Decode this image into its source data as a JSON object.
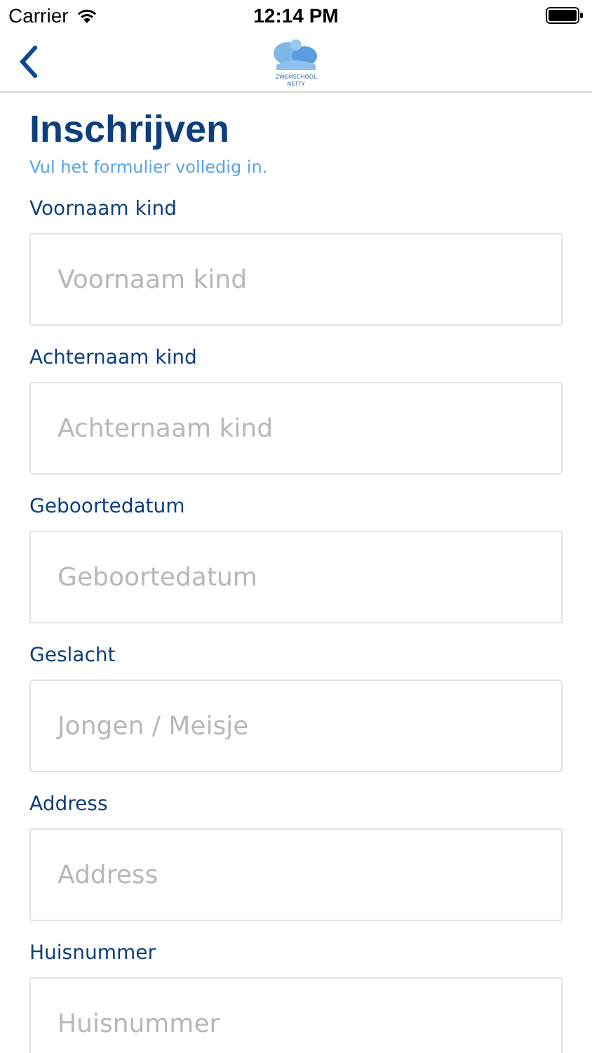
{
  "status_bar": {
    "carrier": "Carrier",
    "time": "12:14 PM"
  },
  "nav": {
    "logo_lines": [
      "ZWEMSCHOOL",
      "NETTY"
    ]
  },
  "title": "Inschrijven",
  "subtitle": "Vul het formulier volledig in.",
  "fields": [
    {
      "label": "Voornaam kind",
      "placeholder": "Voornaam kind"
    },
    {
      "label": "Achternaam kind",
      "placeholder": "Achternaam kind"
    },
    {
      "label": "Geboortedatum",
      "placeholder": "Geboortedatum"
    },
    {
      "label": "Geslacht",
      "placeholder": "Jongen / Meisje"
    },
    {
      "label": "Address",
      "placeholder": "Address"
    },
    {
      "label": "Huisnummer",
      "placeholder": "Huisnummer"
    }
  ]
}
